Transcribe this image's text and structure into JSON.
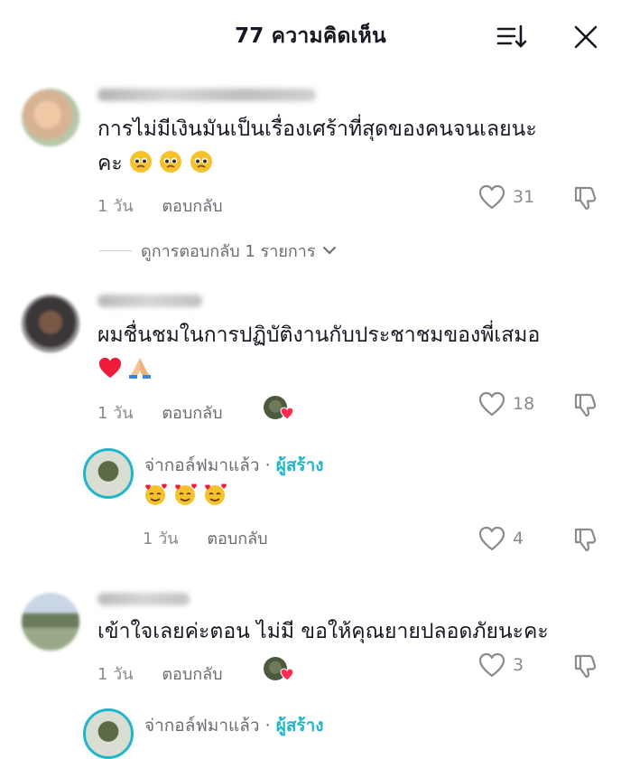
{
  "header": {
    "title": "77 ความคิดเห็น"
  },
  "comments": [
    {
      "text_line1": "การไม่มีเงินมันเป็นเรื่องเศร้าที่สุดของคนจนเลยนะ",
      "text_line2": "คะ",
      "time": "1 วัน",
      "reply_label": "ตอบกลับ",
      "likes": "31",
      "view_replies": "ดูการตอบกลับ 1 รายการ"
    },
    {
      "text_line1": "ผมชื่นชมในการปฏิบัติงานกับประชาชมของพี่เสมอ",
      "time": "1 วัน",
      "reply_label": "ตอบกลับ",
      "likes": "18",
      "reply": {
        "author": "จ่ากอล์ฟมาแล้ว",
        "separator": " · ",
        "badge": "ผู้สร้าง",
        "time": "1 วัน",
        "reply_label": "ตอบกลับ",
        "likes": "4"
      }
    },
    {
      "text_line1": "เข้าใจเลยค่ะตอน ไม่มี ขอให้คุณยายปลอดภัยนะคะ",
      "time": "1 วัน",
      "reply_label": "ตอบกลับ",
      "likes": "3",
      "reply_preview": {
        "author": "จ่ากอล์ฟมาแล้ว",
        "badge": "ผู้สร้าง"
      }
    }
  ],
  "colors": {
    "accent": "#20b6c9",
    "heart": "#fe2c55",
    "muted": "#8a8b91"
  },
  "icons": [
    "sort-icon",
    "close-icon",
    "heart-outline-icon",
    "dislike-icon",
    "chevron-down-icon"
  ]
}
